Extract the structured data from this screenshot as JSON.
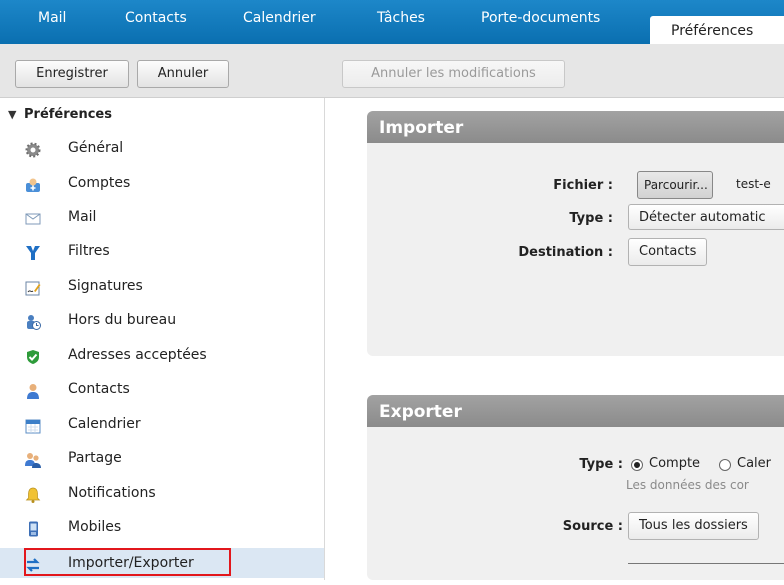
{
  "tabs": [
    {
      "label": "Mail"
    },
    {
      "label": "Contacts"
    },
    {
      "label": "Calendrier"
    },
    {
      "label": "Tâches"
    },
    {
      "label": "Porte-documents"
    },
    {
      "label": "Préférences"
    }
  ],
  "toolbar": {
    "save_label": "Enregistrer",
    "cancel_label": "Annuler",
    "undo_label": "Annuler les modifications"
  },
  "sidebar": {
    "header": "Préférences",
    "items": [
      {
        "label": "Général",
        "icon": "gear-icon"
      },
      {
        "label": "Comptes",
        "icon": "accounts-icon"
      },
      {
        "label": "Mail",
        "icon": "envelope-icon"
      },
      {
        "label": "Filtres",
        "icon": "filter-icon"
      },
      {
        "label": "Signatures",
        "icon": "signature-icon"
      },
      {
        "label": "Hors du bureau",
        "icon": "out-of-office-icon"
      },
      {
        "label": "Adresses acceptées",
        "icon": "shield-check-icon"
      },
      {
        "label": "Contacts",
        "icon": "contact-person-icon"
      },
      {
        "label": "Calendrier",
        "icon": "calendar-icon"
      },
      {
        "label": "Partage",
        "icon": "sharing-icon"
      },
      {
        "label": "Notifications",
        "icon": "bell-icon"
      },
      {
        "label": "Mobiles",
        "icon": "mobile-phone-icon"
      },
      {
        "label": "Importer/Exporter",
        "icon": "import-export-icon"
      }
    ]
  },
  "import": {
    "title": "Importer",
    "file_label": "Fichier :",
    "browse_label": "Parcourir...",
    "file_name": "test-e",
    "type_label": "Type :",
    "type_value": "Détecter automatic",
    "destination_label": "Destination :",
    "destination_value": "Contacts"
  },
  "export": {
    "title": "Exporter",
    "type_label": "Type :",
    "type_option_account": "Compte",
    "type_option_calendar": "Caler",
    "note": "Les données des cor",
    "source_label": "Source :",
    "source_value": "Tous les dossiers"
  },
  "colors": {
    "tabbar": "#0a6fb0",
    "selection_outline": "#e2171c",
    "panel_header": "#929292"
  }
}
